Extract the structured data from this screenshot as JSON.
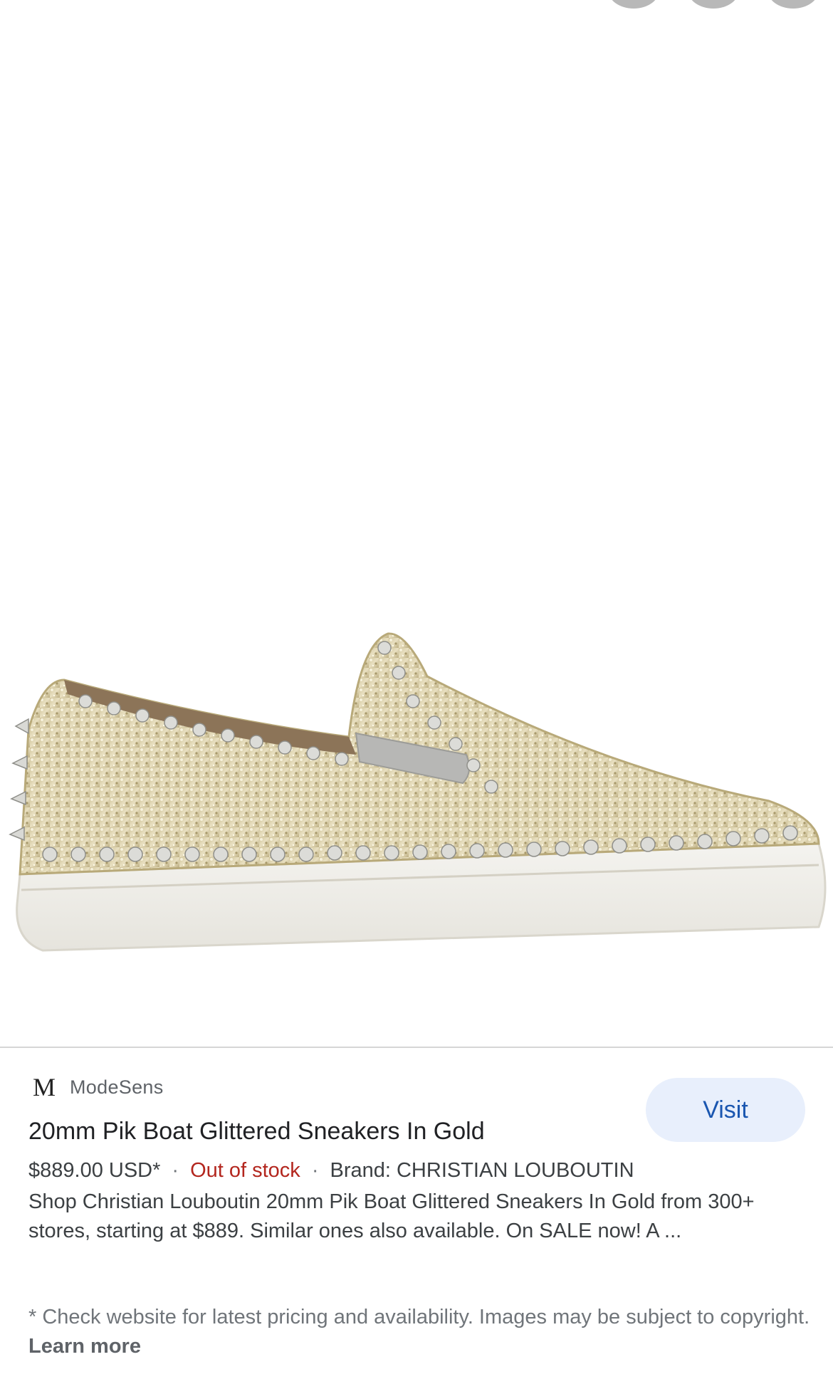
{
  "icons": {
    "top_action_1": "circle-button-icon",
    "top_action_2": "circle-button-icon",
    "top_action_3": "circle-button-icon"
  },
  "product_image": {
    "icon": "glitter-studded-sneaker-image"
  },
  "result": {
    "source_logo": "M",
    "source_name": "ModeSens",
    "visit_label": "Visit",
    "title": "20mm Pik Boat Glittered Sneakers In Gold",
    "price": "$889.00 USD*",
    "separator": "·",
    "stock_status": "Out of stock",
    "brand": "Brand: CHRISTIAN LOUBOUTIN",
    "description": "Shop Christian Louboutin 20mm Pik Boat Glittered Sneakers In Gold from 300+ stores, starting at $889. Similar ones also available. On SALE now! A ...",
    "disclaimer": "* Check website for latest pricing and availability. Images may be subject to copyright.",
    "learn_more": "Learn more"
  },
  "colors": {
    "stock_status": "#b3261e",
    "visit_bg": "#e8effc",
    "visit_text": "#1a56b0"
  }
}
